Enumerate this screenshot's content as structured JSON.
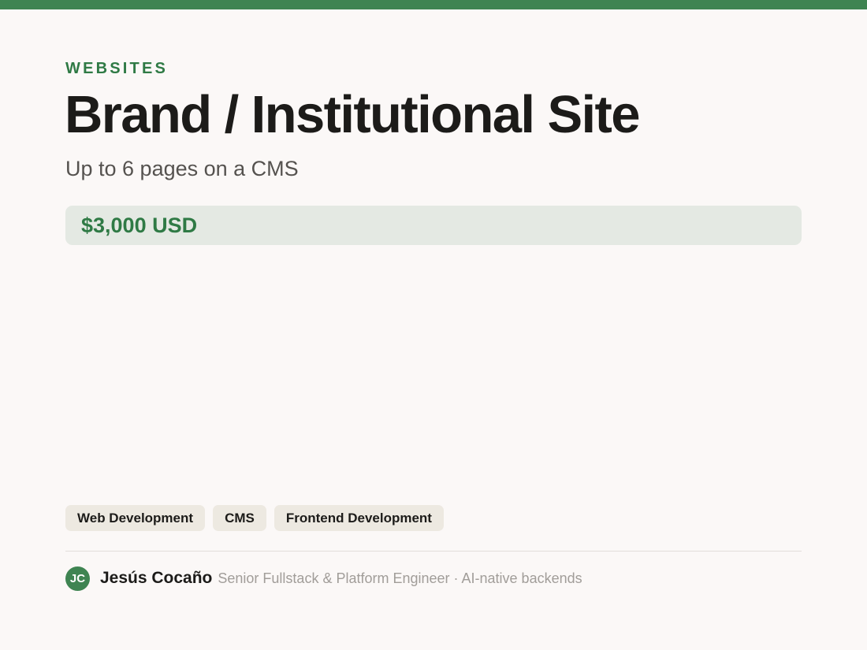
{
  "colors": {
    "accent": "#3f8452",
    "accent_text": "#2f7a45",
    "background": "#fbf8f7",
    "price_background": "#e4e9e3",
    "tag_background": "#ede9e1"
  },
  "header": {
    "category": "WEBSITES",
    "title": "Brand / Institutional Site",
    "subtitle": "Up to 6 pages on a CMS"
  },
  "price": {
    "label": "$3,000 USD"
  },
  "tags": [
    {
      "label": "Web Development"
    },
    {
      "label": "CMS"
    },
    {
      "label": "Frontend Development"
    }
  ],
  "author": {
    "initials": "JC",
    "name": "Jesús Cocaño",
    "role": "Senior Fullstack & Platform Engineer · AI-native backends"
  }
}
